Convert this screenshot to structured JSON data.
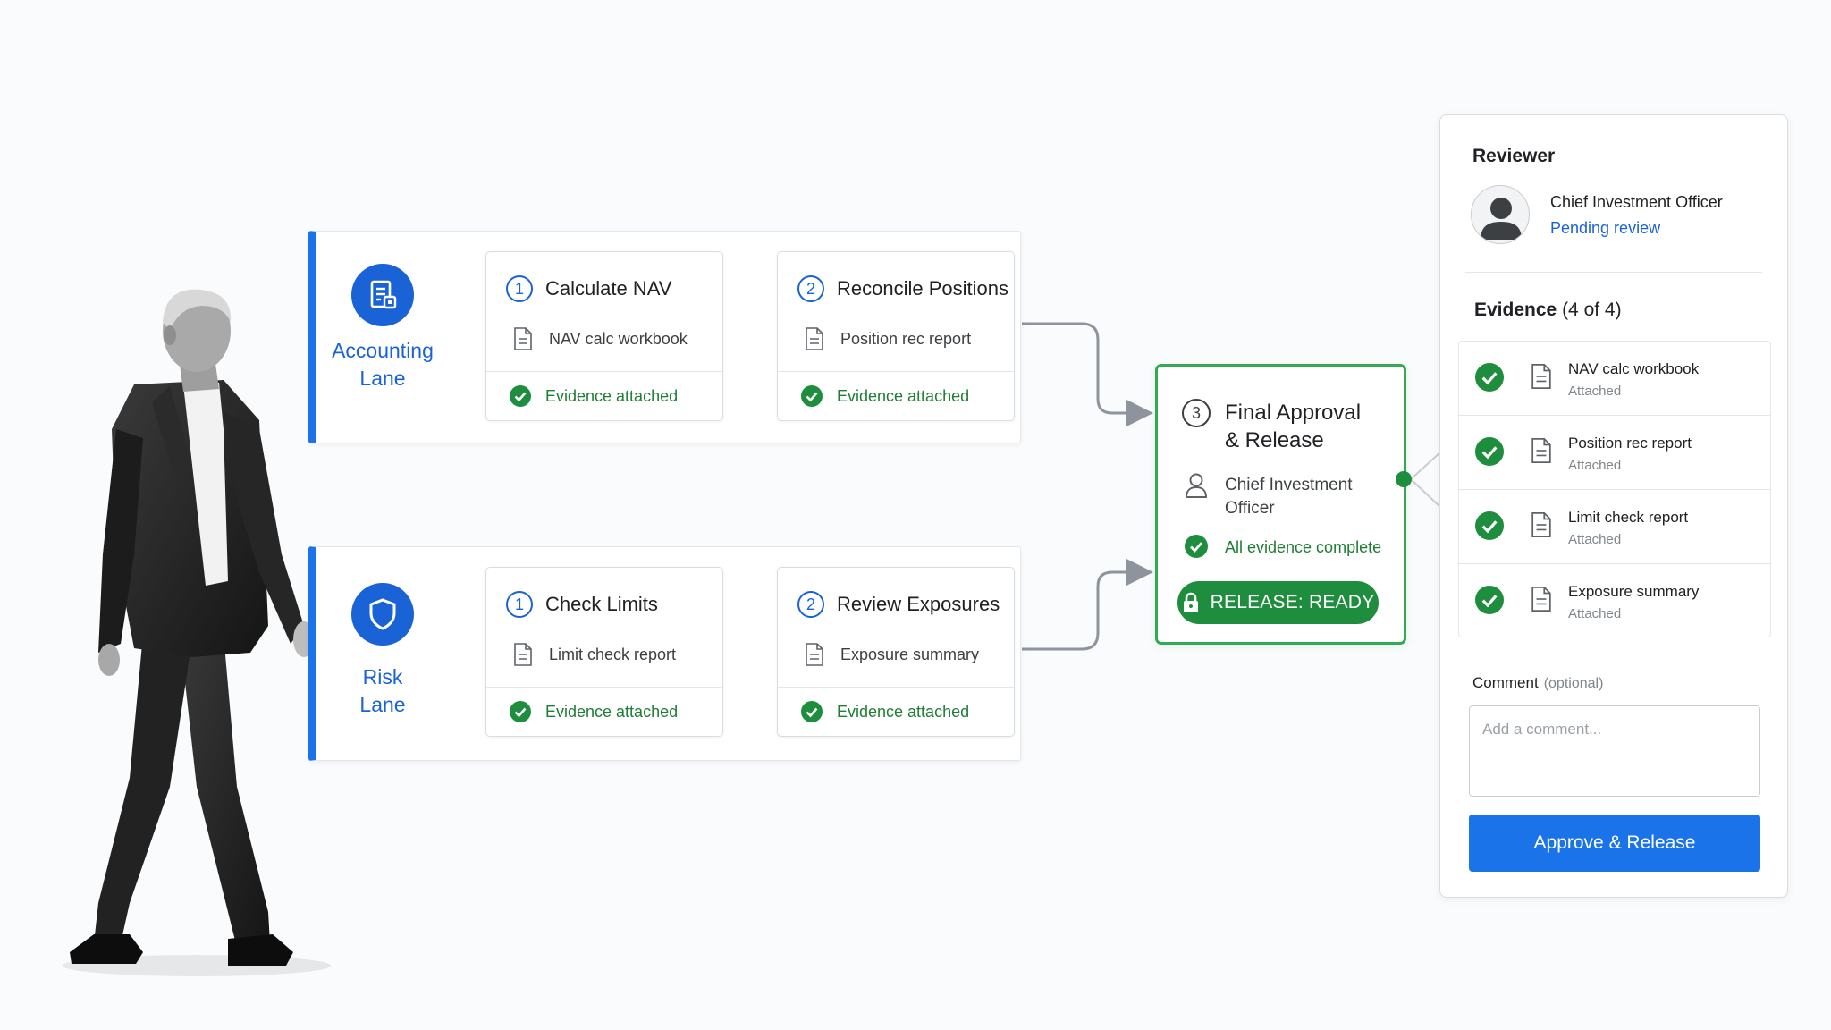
{
  "colors": {
    "accent_blue": "#1a73e8",
    "success_green": "#1e8e3e",
    "lane_border": "#1a73e8"
  },
  "lanes": [
    {
      "title_line1": "Accounting",
      "title_line2": "Lane",
      "icon": "ledger-doc-icon",
      "steps": [
        {
          "num": "1",
          "title": "Calculate NAV",
          "doc": "NAV calc workbook",
          "status": "Evidence attached"
        },
        {
          "num": "2",
          "title": "Reconcile Positions",
          "doc": "Position rec report",
          "status": "Evidence attached"
        }
      ]
    },
    {
      "title_line1": "Risk",
      "title_line2": "Lane",
      "icon": "shield-icon",
      "steps": [
        {
          "num": "1",
          "title": "Check Limits",
          "doc": "Limit check report",
          "status": "Evidence attached"
        },
        {
          "num": "2",
          "title": "Review Exposures",
          "doc": "Exposure summary",
          "status": "Evidence attached"
        }
      ]
    }
  ],
  "final": {
    "num": "3",
    "title_line1": "Final Approval",
    "title_line2": "& Release",
    "owner_line1": "Chief Investment",
    "owner_line2": "Officer",
    "status": "All evidence complete",
    "badge": "RELEASE: READY"
  },
  "panel": {
    "title": "Reviewer",
    "reviewer_role": "Chief Investment Officer",
    "reviewer_status": "Pending review",
    "evidence_label": "Evidence",
    "evidence_count": "(4 of 4)",
    "evidence": [
      {
        "name": "NAV calc workbook",
        "status": "Attached"
      },
      {
        "name": "Position rec report",
        "status": "Attached"
      },
      {
        "name": "Limit check report",
        "status": "Attached"
      },
      {
        "name": "Exposure summary",
        "status": "Attached"
      }
    ],
    "comment_label": "Comment",
    "comment_optional": "(optional)",
    "comment_placeholder": "Add a comment...",
    "comment_value": "",
    "approve_label": "Approve & Release"
  }
}
